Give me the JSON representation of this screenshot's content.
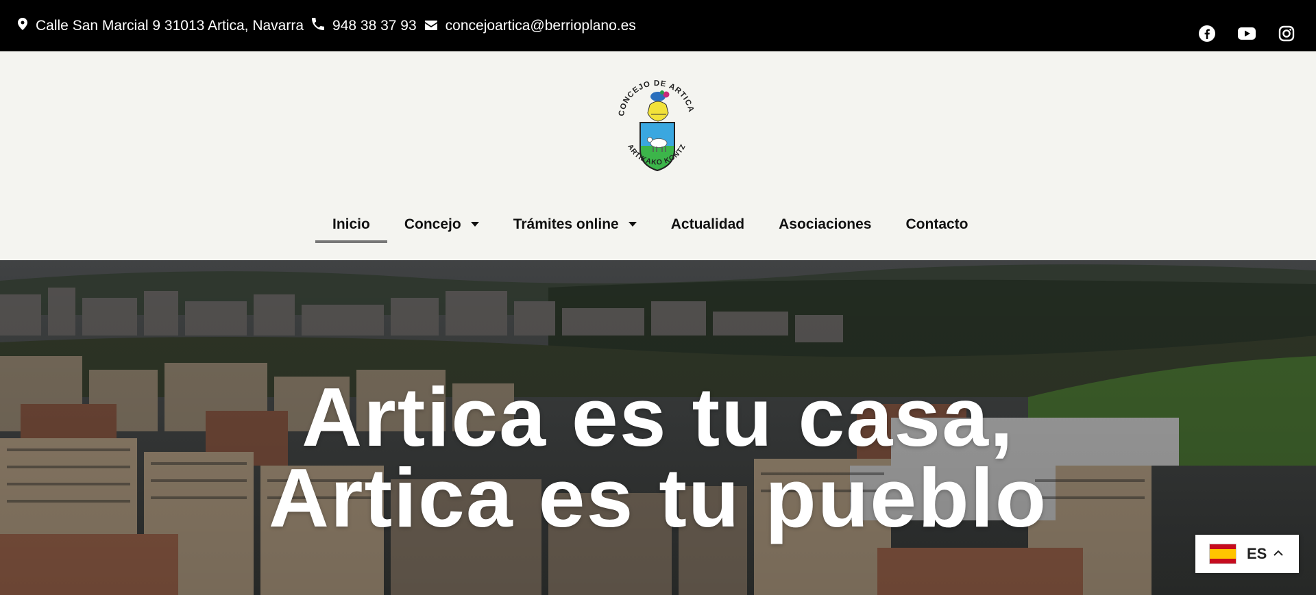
{
  "topbar": {
    "address": "Calle San Marcial 9 31013 Artica, Navarra",
    "phone": "948 38 37 93",
    "email": "concejoartica@berrioplano.es",
    "icons": [
      "map-pin-icon",
      "phone-icon",
      "envelope-icon"
    ],
    "social": [
      "facebook-icon",
      "youtube-icon",
      "instagram-icon"
    ]
  },
  "logo": {
    "top_text": "CONCEJO DE ARTICA",
    "bottom_text": "ARTIKAKO KONTZEJUA"
  },
  "nav": {
    "items": [
      {
        "label": "Inicio",
        "active": true,
        "dropdown": false
      },
      {
        "label": "Concejo",
        "active": false,
        "dropdown": true
      },
      {
        "label": "Trámites online",
        "active": false,
        "dropdown": true
      },
      {
        "label": "Actualidad",
        "active": false,
        "dropdown": false
      },
      {
        "label": "Asociaciones",
        "active": false,
        "dropdown": false
      },
      {
        "label": "Contacto",
        "active": false,
        "dropdown": false
      }
    ]
  },
  "hero": {
    "line1": "Artica es tu casa,",
    "line2": "Artica es tu pueblo"
  },
  "language": {
    "code": "ES"
  },
  "colors": {
    "topbar": "#000000",
    "header": "#f4f4f0",
    "active_underline": "#777777"
  }
}
